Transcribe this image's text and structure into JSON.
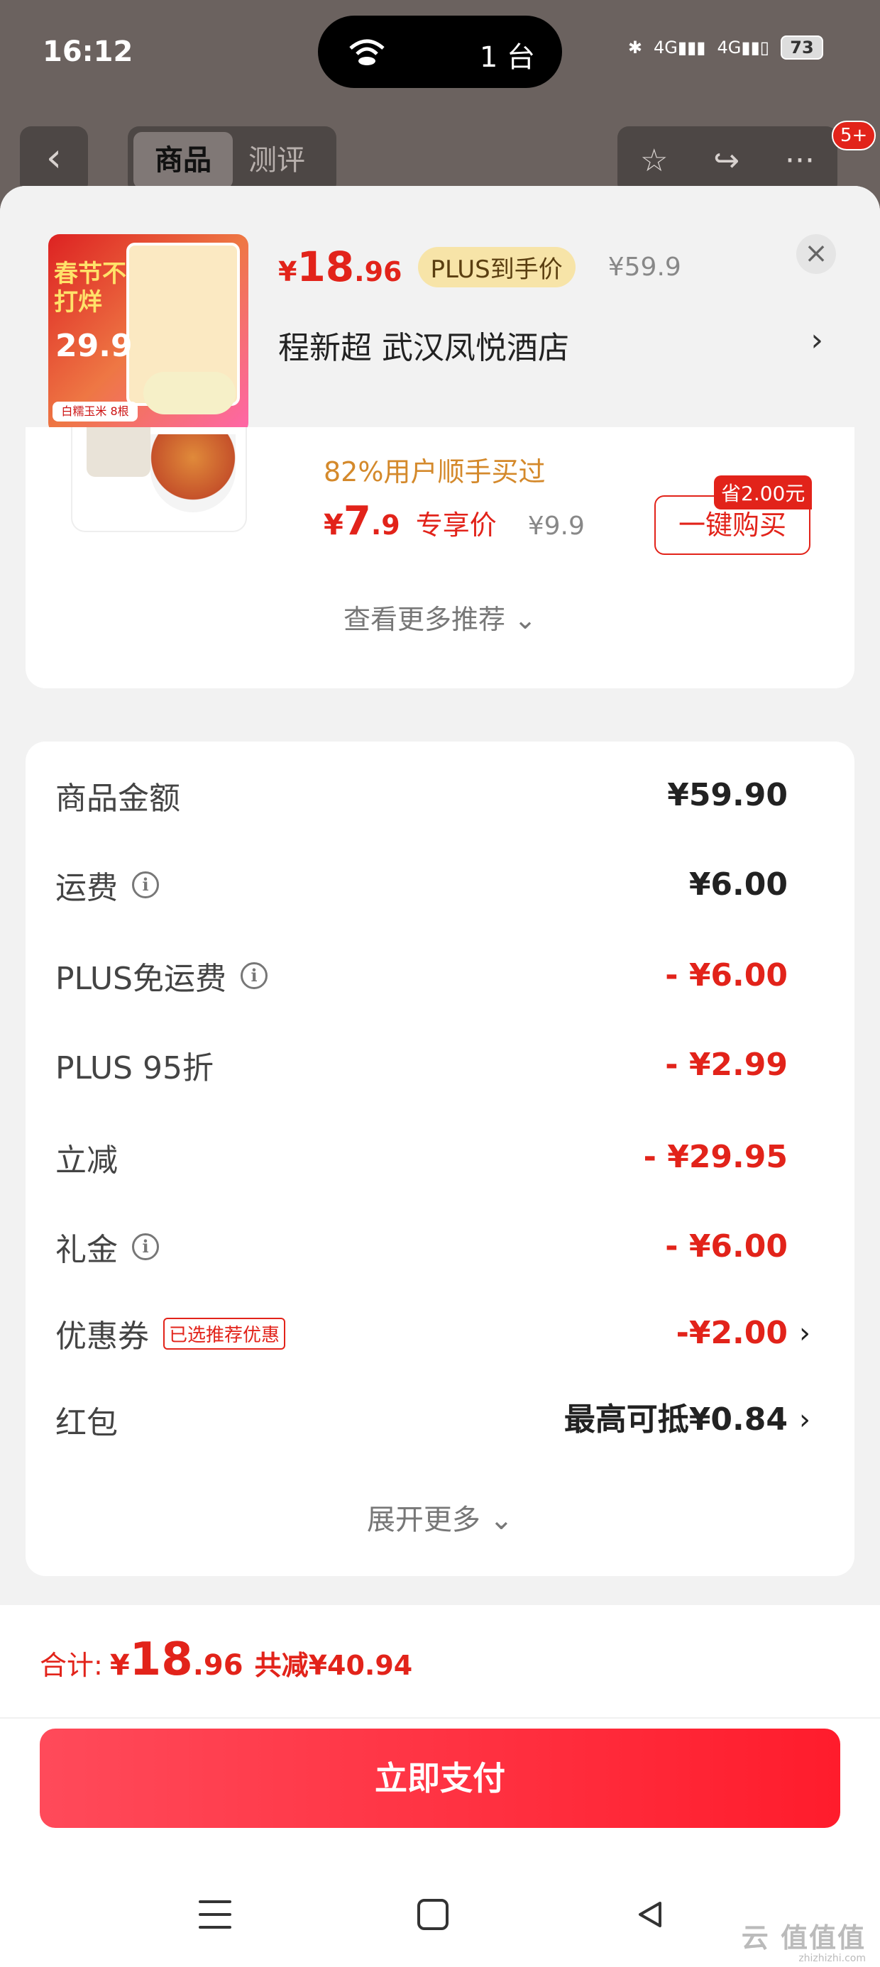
{
  "status": {
    "time": "16:12",
    "island_count": "1 台",
    "battery": "73",
    "net1": "4G",
    "net2": "4G"
  },
  "bgnav": {
    "tab_product": "商品",
    "tab_review": "测评",
    "badge": "5+"
  },
  "product": {
    "price_int": "18",
    "price_dec": ".96",
    "currency": "¥",
    "plus_tag": "PLUS到手价",
    "orig_price": "¥59.9",
    "address": "程新超  武汉凤悦酒店",
    "img_text": "春节不打烊",
    "img_price": "29.9",
    "img_label": "白糯玉米 8根"
  },
  "recommend": {
    "bought_pct": "82%用户顺手买过",
    "currency": "¥",
    "price_int": "7",
    "price_dec": ".9",
    "tag": "专享价",
    "orig": "¥9.9",
    "save_badge": "省2.00元",
    "buy_label": "一键购买",
    "more": "查看更多推荐 ⌄"
  },
  "amounts": {
    "rows": [
      {
        "label": "商品金额",
        "value": "¥59.90"
      },
      {
        "label": "运费",
        "value": "¥6.00"
      },
      {
        "label": "PLUS免运费",
        "value": "- ¥6.00"
      },
      {
        "label": "PLUS 95折",
        "value": "- ¥2.99"
      },
      {
        "label": "立减",
        "value": "- ¥29.95"
      },
      {
        "label": "礼金",
        "value": "- ¥6.00"
      },
      {
        "label": "优惠券",
        "tag": "已选推荐优惠",
        "value": "-¥2.00"
      },
      {
        "label": "红包",
        "value": "最高可抵¥0.84"
      }
    ],
    "expand": "展开更多 ⌄"
  },
  "footer": {
    "total_label": "合计:",
    "currency": "¥",
    "total_int": "18",
    "total_dec": ".96",
    "saved": "共减¥40.94",
    "pay_label": "立即支付"
  },
  "watermark": {
    "main": "云 值值值",
    "sub": "zhizhizhi.com"
  },
  "colors": {
    "accent_red": "#e2231a",
    "plus_gold": "#f7e4a8",
    "recommend_orange": "#d4892b"
  }
}
